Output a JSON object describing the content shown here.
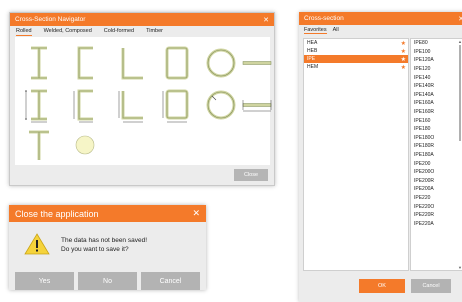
{
  "navigator": {
    "title": "Cross-Section Navigator",
    "tabs": [
      {
        "label": "Rolled",
        "active": true
      },
      {
        "label": "Welded, Composed",
        "active": false
      },
      {
        "label": "Cold-formed",
        "active": false
      },
      {
        "label": "Timber",
        "active": false
      }
    ],
    "close_label": "Close",
    "shape_icons": [
      "i-section-icon",
      "channel-section-icon",
      "angle-section-icon",
      "rect-hollow-section-icon",
      "circular-hollow-section-icon",
      "flat-bar-icon",
      "i-section-dimensioned-icon",
      "channel-section-dimensioned-icon",
      "angle-section-dimensioned-icon",
      "rect-hollow-section-dimensioned-icon",
      "circular-hollow-section-dimensioned-icon",
      "flat-bar-dimensioned-icon",
      "t-section-icon",
      "round-bar-icon"
    ],
    "accent_color": "#f47a2a"
  },
  "dialog": {
    "title": "Close the application",
    "message_line1": "The data has not been saved!",
    "message_line2": "Do you want to save it?",
    "buttons": {
      "yes": "Yes",
      "no": "No",
      "cancel": "Cancel"
    },
    "icon": "warning-icon"
  },
  "cross_section": {
    "title": "Cross-section",
    "tabs": [
      {
        "label": "Favorites",
        "active": true
      },
      {
        "label": "All",
        "active": false
      }
    ],
    "families": [
      {
        "name": "HEA",
        "selected": false
      },
      {
        "name": "HEB",
        "selected": false
      },
      {
        "name": "IPE",
        "selected": true
      },
      {
        "name": "HEM",
        "selected": false
      }
    ],
    "profiles": [
      "IPE80",
      "IPE100",
      "IPE120A",
      "IPE120",
      "IPE140",
      "IPE140R",
      "IPE140A",
      "IPE160A",
      "IPE160R",
      "IPE160",
      "IPE180",
      "IPE180O",
      "IPE180R",
      "IPE180A",
      "IPE200",
      "IPE200O",
      "IPE200R",
      "IPE200A",
      "IPE220",
      "IPE220O",
      "IPE220R",
      "IPE220A"
    ],
    "ok_label": "OK",
    "cancel_label": "Cancel"
  }
}
